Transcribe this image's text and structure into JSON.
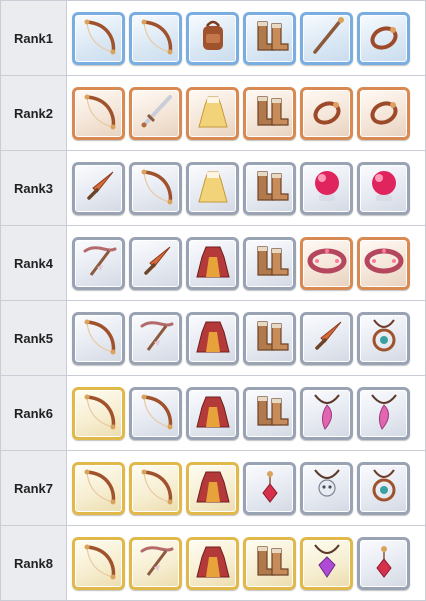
{
  "frame_colors": {
    "blue": "#7aaee0",
    "copper": "#d88a52",
    "silver": "#9aa3b4",
    "gold": "#e1b94a"
  },
  "rows": [
    {
      "rank": "Rank1",
      "items": [
        {
          "icon": "bow-icon",
          "frame": "blue"
        },
        {
          "icon": "bow-icon",
          "frame": "blue"
        },
        {
          "icon": "backpack-icon",
          "frame": "blue"
        },
        {
          "icon": "boots-icon",
          "frame": "blue"
        },
        {
          "icon": "staff-icon",
          "frame": "blue"
        },
        {
          "icon": "ring-icon",
          "frame": "blue"
        }
      ]
    },
    {
      "rank": "Rank2",
      "items": [
        {
          "icon": "bow-icon",
          "frame": "copper"
        },
        {
          "icon": "sword-icon",
          "frame": "copper"
        },
        {
          "icon": "dress-icon",
          "frame": "copper"
        },
        {
          "icon": "boots-icon",
          "frame": "copper"
        },
        {
          "icon": "ring-icon",
          "frame": "copper"
        },
        {
          "icon": "ring-icon",
          "frame": "copper"
        }
      ]
    },
    {
      "rank": "Rank3",
      "items": [
        {
          "icon": "dagger-icon",
          "frame": "silver"
        },
        {
          "icon": "bow-icon",
          "frame": "silver"
        },
        {
          "icon": "dress-icon",
          "frame": "silver"
        },
        {
          "icon": "boots-icon",
          "frame": "silver"
        },
        {
          "icon": "orb-icon",
          "frame": "silver"
        },
        {
          "icon": "orb-icon",
          "frame": "silver"
        }
      ]
    },
    {
      "rank": "Rank4",
      "items": [
        {
          "icon": "crossbow-icon",
          "frame": "silver"
        },
        {
          "icon": "dagger-icon",
          "frame": "silver"
        },
        {
          "icon": "robe-icon",
          "frame": "silver"
        },
        {
          "icon": "boots-icon",
          "frame": "silver"
        },
        {
          "icon": "bracelet-icon",
          "frame": "copper"
        },
        {
          "icon": "bracelet-icon",
          "frame": "copper"
        }
      ]
    },
    {
      "rank": "Rank5",
      "items": [
        {
          "icon": "bow-icon",
          "frame": "silver"
        },
        {
          "icon": "crossbow-icon",
          "frame": "silver"
        },
        {
          "icon": "robe-icon",
          "frame": "silver"
        },
        {
          "icon": "boots-icon",
          "frame": "silver"
        },
        {
          "icon": "dagger-icon",
          "frame": "silver"
        },
        {
          "icon": "amulet-icon",
          "frame": "silver"
        }
      ]
    },
    {
      "rank": "Rank6",
      "items": [
        {
          "icon": "bow-icon",
          "frame": "gold"
        },
        {
          "icon": "bow-icon",
          "frame": "silver"
        },
        {
          "icon": "robe-icon",
          "frame": "silver"
        },
        {
          "icon": "boots-icon",
          "frame": "silver"
        },
        {
          "icon": "feather-necklace-icon",
          "frame": "silver"
        },
        {
          "icon": "feather-necklace-icon",
          "frame": "silver"
        }
      ]
    },
    {
      "rank": "Rank7",
      "items": [
        {
          "icon": "bow-icon",
          "frame": "gold"
        },
        {
          "icon": "bow-icon",
          "frame": "gold"
        },
        {
          "icon": "robe-icon",
          "frame": "gold"
        },
        {
          "icon": "earring-icon",
          "frame": "silver"
        },
        {
          "icon": "skull-pendant-icon",
          "frame": "silver"
        },
        {
          "icon": "amulet-icon",
          "frame": "silver"
        }
      ]
    },
    {
      "rank": "Rank8",
      "items": [
        {
          "icon": "bow-icon",
          "frame": "gold"
        },
        {
          "icon": "crossbow-icon",
          "frame": "gold"
        },
        {
          "icon": "robe-icon",
          "frame": "gold"
        },
        {
          "icon": "boots-icon",
          "frame": "gold"
        },
        {
          "icon": "gem-pendant-icon",
          "frame": "gold"
        },
        {
          "icon": "earring-icon",
          "frame": "silver"
        }
      ]
    }
  ]
}
